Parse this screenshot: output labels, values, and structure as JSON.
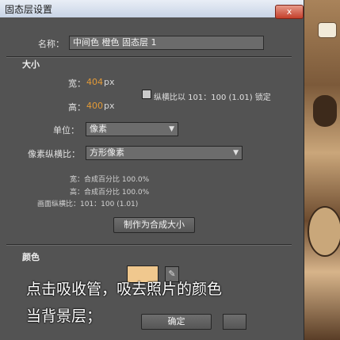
{
  "dialog": {
    "title": "固态层设置",
    "close_glyph": "x",
    "name_label": "名称：",
    "name_value": "中间色 橙色 固态层 1"
  },
  "size": {
    "section_label": "大小",
    "width_label": "宽：",
    "width_value": "404",
    "width_unit": "px",
    "height_label": "高：",
    "height_value": "400",
    "height_unit": "px",
    "lock_label": "纵横比以 101：100 (1.01) 锁定",
    "units_label": "单位：",
    "units_value": "像素",
    "pixel_aspect_label": "像素纵横比：",
    "pixel_aspect_value": "方形像素",
    "info_width": "宽：合成百分比 100.0%",
    "info_height": "高：合成百分比 100.0%",
    "info_aspect": "画面纵横比：101：100 (1.01)",
    "make_comp_size_button": "制作为合成大小"
  },
  "color": {
    "section_label": "颜色",
    "swatch_hex": "#f0c88e"
  },
  "footer": {
    "ok_button": "确定"
  },
  "overlay": {
    "line1": "点击吸收管，吸去照片的颜色",
    "line2": "当背景层；"
  },
  "colors": {
    "dialog_bg": "#535353",
    "number_accent": "#e39a37",
    "close_red": "#c4402b"
  },
  "icons": {
    "dropper": "eyedropper-icon",
    "dropdown": "chevron-down-icon"
  }
}
